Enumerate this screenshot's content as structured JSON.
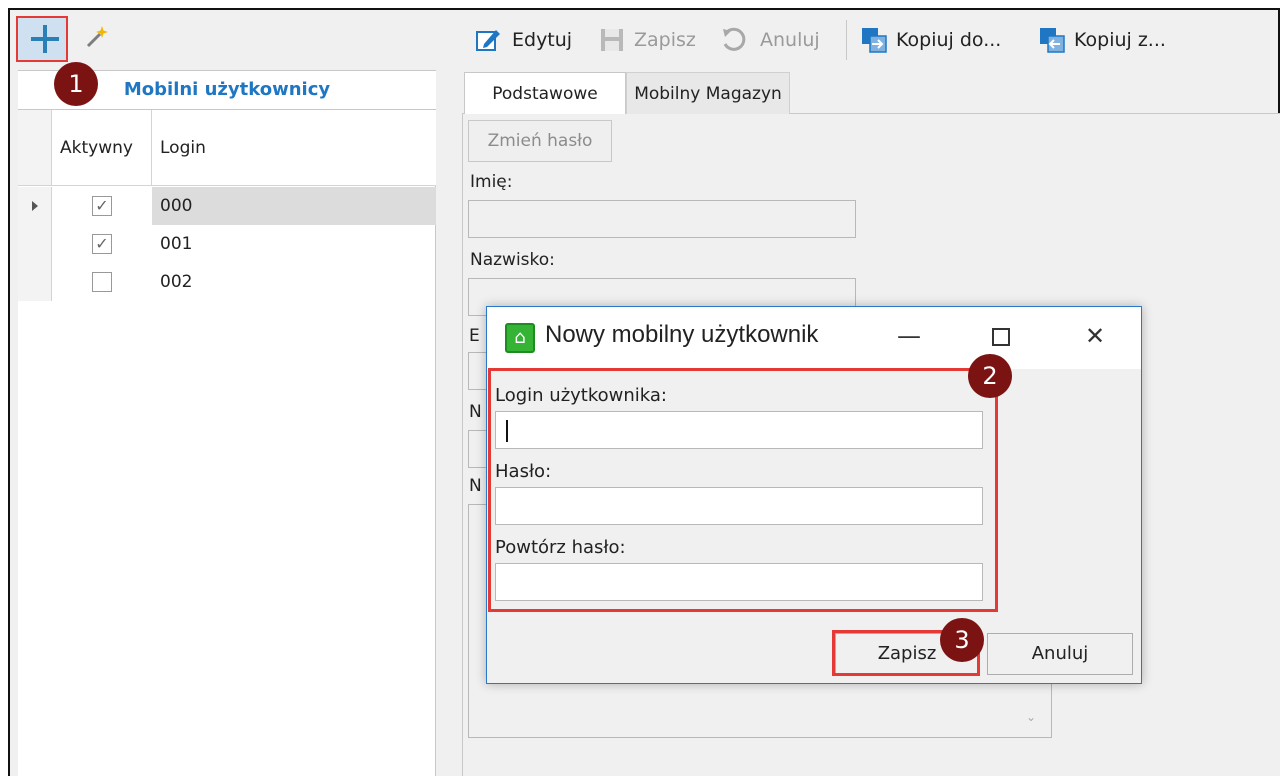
{
  "left": {
    "add_icon": "plus-icon",
    "wand_icon": "magic-wand-icon",
    "grid_title": "Mobilni użytkownicy",
    "columns": [
      "Aktywny",
      "Login"
    ],
    "rows": [
      {
        "active": true,
        "login": "000",
        "selected": true
      },
      {
        "active": true,
        "login": "001",
        "selected": false
      },
      {
        "active": false,
        "login": "002",
        "selected": false
      }
    ]
  },
  "toolbar": {
    "edit_label": "Edytuj",
    "save_label": "Zapisz",
    "cancel_label": "Anuluj",
    "copy_to_label": "Kopiuj do...",
    "copy_from_label": "Kopiuj z..."
  },
  "tabs": [
    {
      "label": "Podstawowe",
      "active": true
    },
    {
      "label": "Mobilny Magazyn",
      "active": false
    }
  ],
  "form": {
    "change_password_label": "Zmień hasło",
    "first_name_label": "Imię:",
    "last_name_label": "Nazwisko:",
    "email_label_partial": "E",
    "number_label_partial": "N",
    "notes_label_partial": "N"
  },
  "dialog": {
    "title": "Nowy mobilny użytkownik",
    "login_label": "Login użytkownika:",
    "password_label": "Hasło:",
    "repeat_password_label": "Powtórz hasło:",
    "save_label": "Zapisz",
    "cancel_label": "Anuluj",
    "minimize_glyph": "—",
    "close_glyph": "✕"
  },
  "markers": [
    "1",
    "2",
    "3"
  ],
  "colors": {
    "accent": "#1f77c4",
    "marker": "#7b1313",
    "highlight": "#e53935",
    "dialog_border": "#2a78c9"
  }
}
